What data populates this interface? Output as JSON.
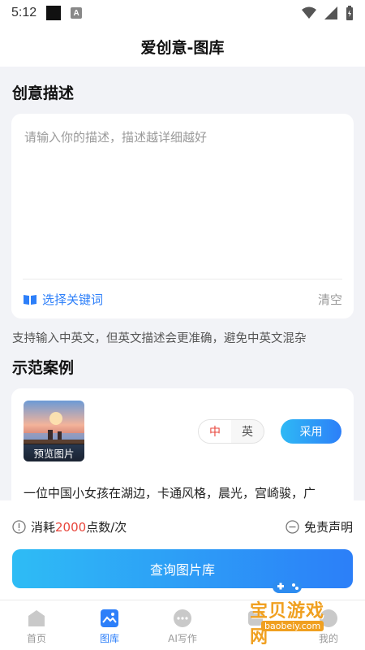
{
  "status_bar": {
    "time": "5:12",
    "notif_letter": "A"
  },
  "nav": {
    "title": "爱创意-图库"
  },
  "description": {
    "section_title": "创意描述",
    "placeholder": "请输入你的描述，描述越详细越好",
    "keyword_label": "选择关键词",
    "clear_label": "清空"
  },
  "hint": "支持输入中英文，但英文描述会更准确，避免中英文混杂",
  "examples": {
    "section_title": "示范案例",
    "preview_label": "预览图片",
    "lang_zh": "中",
    "lang_en": "英",
    "adopt_label": "采用",
    "text": "一位中国小女孩在湖边，卡通风格，晨光，宫崎骏，广"
  },
  "cost": {
    "prefix": "消耗",
    "amount": "2000",
    "suffix": "点数/次"
  },
  "disclaimer_label": "免责声明",
  "query_button": "查询图片库",
  "tabs": [
    {
      "label": "首页",
      "icon": "home-icon",
      "active": false
    },
    {
      "label": "图库",
      "icon": "gallery-icon",
      "active": true
    },
    {
      "label": "AI写作",
      "icon": "chat-icon",
      "active": false
    },
    {
      "label": "",
      "icon": "tool-icon",
      "active": false
    },
    {
      "label": "我的",
      "icon": "profile-icon",
      "active": false
    }
  ],
  "watermark": {
    "text": "宝贝游戏网",
    "url": "baobeiy.com"
  },
  "colors": {
    "accent": "#2d7ff9",
    "highlight": "#e8463c",
    "background": "#f2f3f7"
  }
}
